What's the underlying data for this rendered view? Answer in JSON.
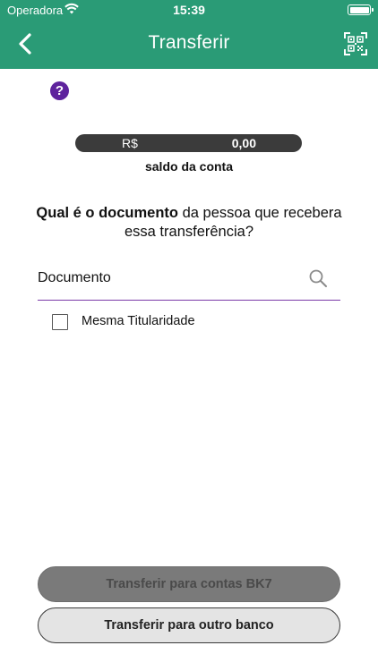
{
  "status_bar": {
    "carrier": "Operadora",
    "time": "15:39"
  },
  "nav": {
    "title": "Transferir",
    "back_icon": "chevron-left-icon",
    "right_icon": "qr-code-icon"
  },
  "help": {
    "symbol": "?"
  },
  "balance": {
    "currency": "R$",
    "value": "0,00",
    "label": "saldo da conta"
  },
  "question": {
    "bold_part": "Qual é o documento",
    "rest_part": " da pessoa que recebera essa transferência?"
  },
  "document": {
    "placeholder": "Documento",
    "value": ""
  },
  "same_owner": {
    "label": "Mesma Titularidade",
    "checked": false
  },
  "buttons": {
    "bk7_label": "Transferir para contas BK7",
    "other_bank_label": "Transferir para outro banco"
  },
  "colors": {
    "header": "#2a9b76",
    "accent": "#5e239d",
    "balance_bar": "#3b3b3b"
  }
}
